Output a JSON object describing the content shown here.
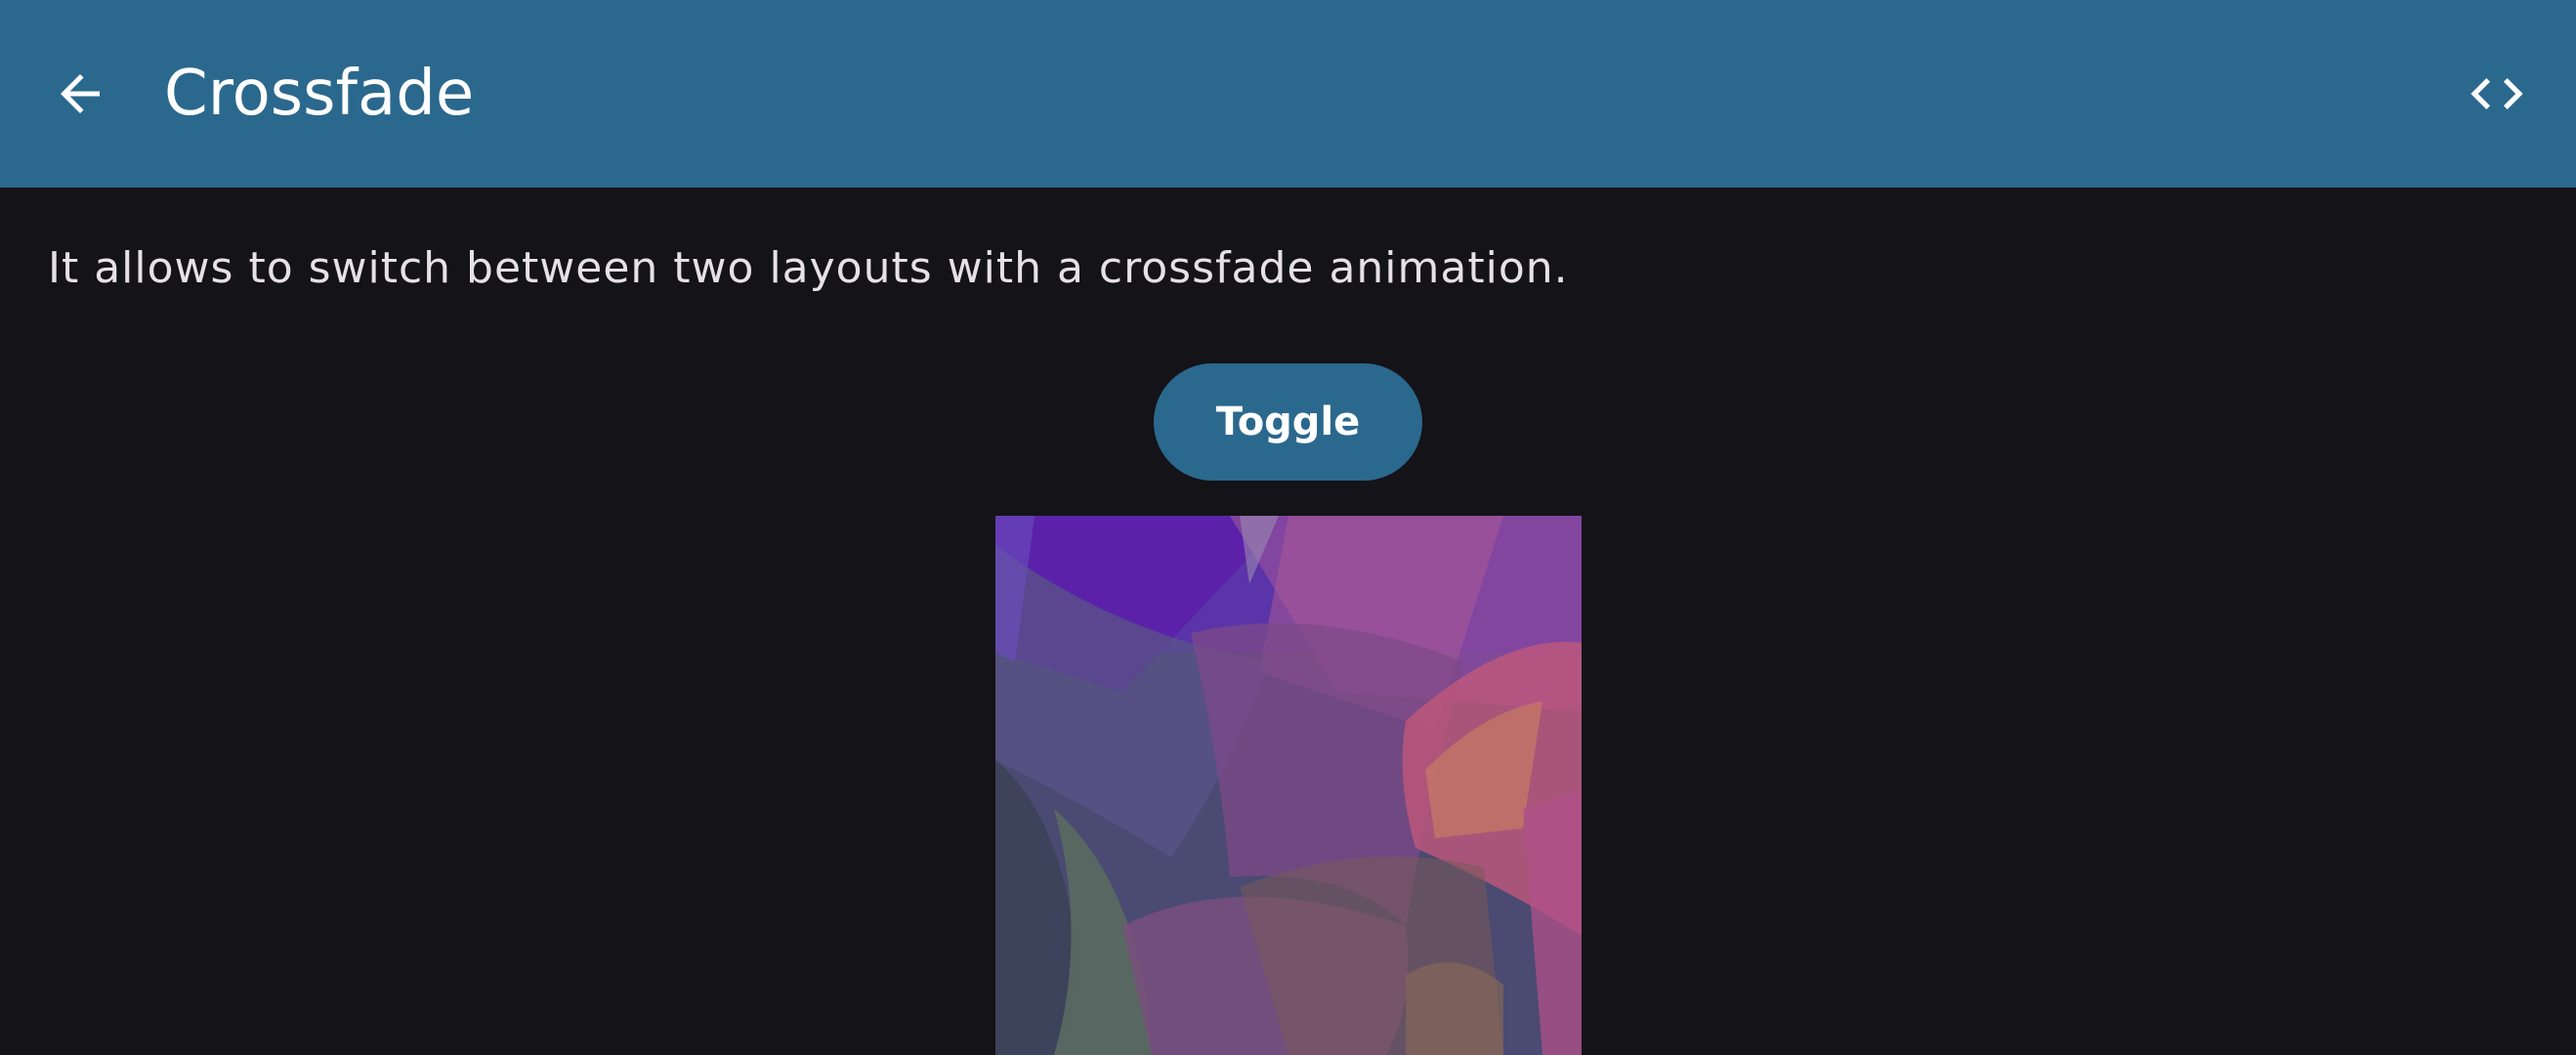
{
  "appbar": {
    "title": "Crossfade",
    "back_icon": "arrow-left-icon",
    "code_icon": "code-brackets-icon",
    "background_color": "#2b688d"
  },
  "content": {
    "description": "It allows to switch between two layouts with a crossfade animation.",
    "toggle_label": "Toggle",
    "background_color": "#141318"
  },
  "artwork": {
    "description_icon": "abstract-gradient-image"
  }
}
